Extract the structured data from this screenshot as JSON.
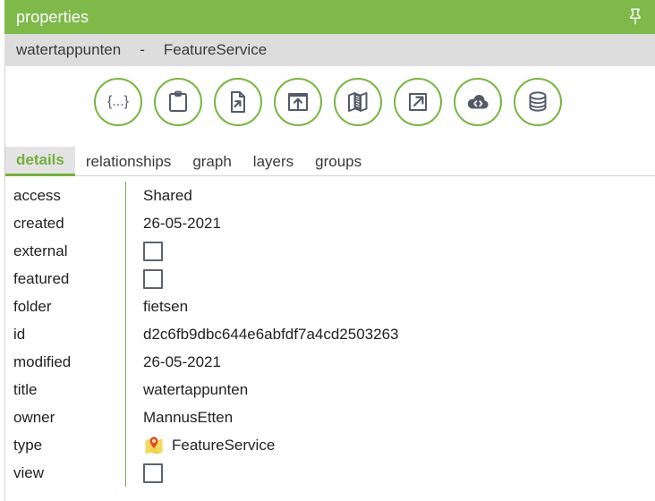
{
  "window": {
    "title": "properties",
    "pin_icon": "pushpin-icon",
    "accent_green": "#7eb94a",
    "subtitle_bg": "#dddddd"
  },
  "subtitle": {
    "item_name": "watertappunten",
    "separator": "-",
    "item_type": "FeatureService"
  },
  "toolbar": {
    "buttons": [
      {
        "name": "json-icon",
        "label": "{...}"
      },
      {
        "name": "clipboard-icon",
        "label": ""
      },
      {
        "name": "file-export-icon",
        "label": ""
      },
      {
        "name": "upload-box-icon",
        "label": ""
      },
      {
        "name": "map-icon",
        "label": ""
      },
      {
        "name": "open-external-icon",
        "label": ""
      },
      {
        "name": "cloud-code-icon",
        "label": ""
      },
      {
        "name": "database-icon",
        "label": ""
      }
    ],
    "circle_color": "#77b541",
    "glyph_color": "#545b66"
  },
  "tabs": [
    {
      "label": "details",
      "active": true
    },
    {
      "label": "relationships",
      "active": false
    },
    {
      "label": "graph",
      "active": false
    },
    {
      "label": "layers",
      "active": false
    },
    {
      "label": "groups",
      "active": false
    }
  ],
  "details": {
    "rows": [
      {
        "key": "access",
        "value": "Shared",
        "kind": "text"
      },
      {
        "key": "created",
        "value": "26-05-2021",
        "kind": "text"
      },
      {
        "key": "external",
        "value": "",
        "kind": "checkbox",
        "checked": false
      },
      {
        "key": "featured",
        "value": "",
        "kind": "checkbox",
        "checked": false
      },
      {
        "key": "folder",
        "value": "fietsen",
        "kind": "text"
      },
      {
        "key": "id",
        "value": "d2c6fb9dbc644e6abfdf7a4cd2503263",
        "kind": "text"
      },
      {
        "key": "modified",
        "value": "26-05-2021",
        "kind": "text"
      },
      {
        "key": "title",
        "value": "watertappunten",
        "kind": "text"
      },
      {
        "key": "owner",
        "value": "MannusEtten",
        "kind": "text"
      },
      {
        "key": "type",
        "value": "FeatureService",
        "kind": "icon-text",
        "icon": "map-pin-icon"
      },
      {
        "key": "view",
        "value": "",
        "kind": "checkbox",
        "checked": false
      }
    ],
    "divider_color": "#7fae4c"
  }
}
